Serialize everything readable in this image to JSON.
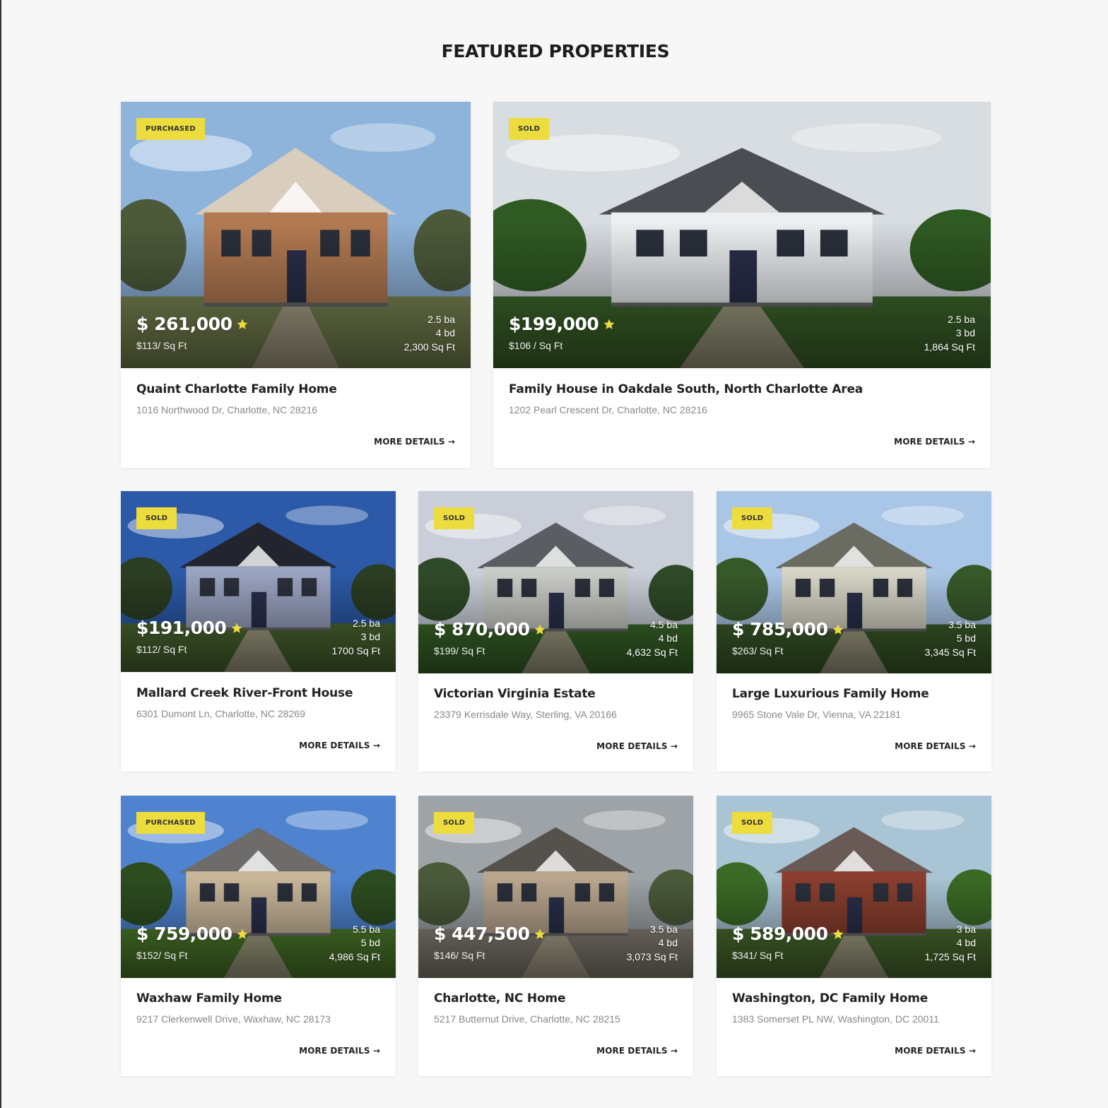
{
  "section_title": "FEATURED PROPERTIES",
  "more_details_label": "MORE DETAILS →",
  "accent_color": "#ecdc3d",
  "properties": [
    {
      "badge": "PURCHASED",
      "price": "$ 261,000",
      "per_sqft": "$113/ Sq Ft",
      "baths": "2.5 ba",
      "beds": "4 bd",
      "sqft": "2,300 Sq Ft",
      "title": "Quaint Charlotte Family Home",
      "address": "1016 Northwood Dr, Charlotte, NC 28216"
    },
    {
      "badge": "SOLD",
      "price": "$199,000",
      "per_sqft": "$106 / Sq Ft",
      "baths": "2.5 ba",
      "beds": "3 bd",
      "sqft": "1,864 Sq Ft",
      "title": "Family House in Oakdale South, North Charlotte Area",
      "address": "1202 Pearl Crescent Dr, Charlotte, NC 28216"
    },
    {
      "badge": "SOLD",
      "price": "$191,000",
      "per_sqft": "$112/ Sq Ft",
      "baths": "2.5 ba",
      "beds": "3 bd",
      "sqft": "1700 Sq Ft",
      "title": "Mallard Creek River-Front House",
      "address": "6301 Dumont Ln, Charlotte, NC 28269"
    },
    {
      "badge": "SOLD",
      "price": "$ 870,000",
      "per_sqft": "$199/ Sq Ft",
      "baths": "4.5 ba",
      "beds": "4 bd",
      "sqft": "4,632 Sq Ft",
      "title": "Victorian Virginia Estate",
      "address": "23379 Kerrisdale Way, Sterling, VA 20166"
    },
    {
      "badge": "SOLD",
      "price": "$ 785,000",
      "per_sqft": "$263/ Sq Ft",
      "baths": "3.5 ba",
      "beds": "5 bd",
      "sqft": "3,345 Sq Ft",
      "title": "Large Luxurious Family Home",
      "address": "9965 Stone Vale Dr, Vienna, VA 22181"
    },
    {
      "badge": "PURCHASED",
      "price": "$ 759,000",
      "per_sqft": "$152/ Sq Ft",
      "baths": "5.5 ba",
      "beds": "5 bd",
      "sqft": "4,986 Sq Ft",
      "title": "Waxhaw Family Home",
      "address": "9217 Clerkenwell Drive, Waxhaw, NC 28173"
    },
    {
      "badge": "SOLD",
      "price": "$ 447,500",
      "per_sqft": "$146/ Sq Ft",
      "baths": "3.5 ba",
      "beds": "4 bd",
      "sqft": "3,073 Sq Ft",
      "title": "Charlotte, NC Home",
      "address": "5217 Butternut Drive, Charlotte, NC 28215"
    },
    {
      "badge": "SOLD",
      "price": "$ 589,000",
      "per_sqft": "$341/ Sq Ft",
      "baths": "3 ba",
      "beds": "4 bd",
      "sqft": "1,725 Sq Ft",
      "title": "Washington, DC Family Home",
      "address": "1383 Somerset PL NW, Washington, DC 20011"
    }
  ]
}
